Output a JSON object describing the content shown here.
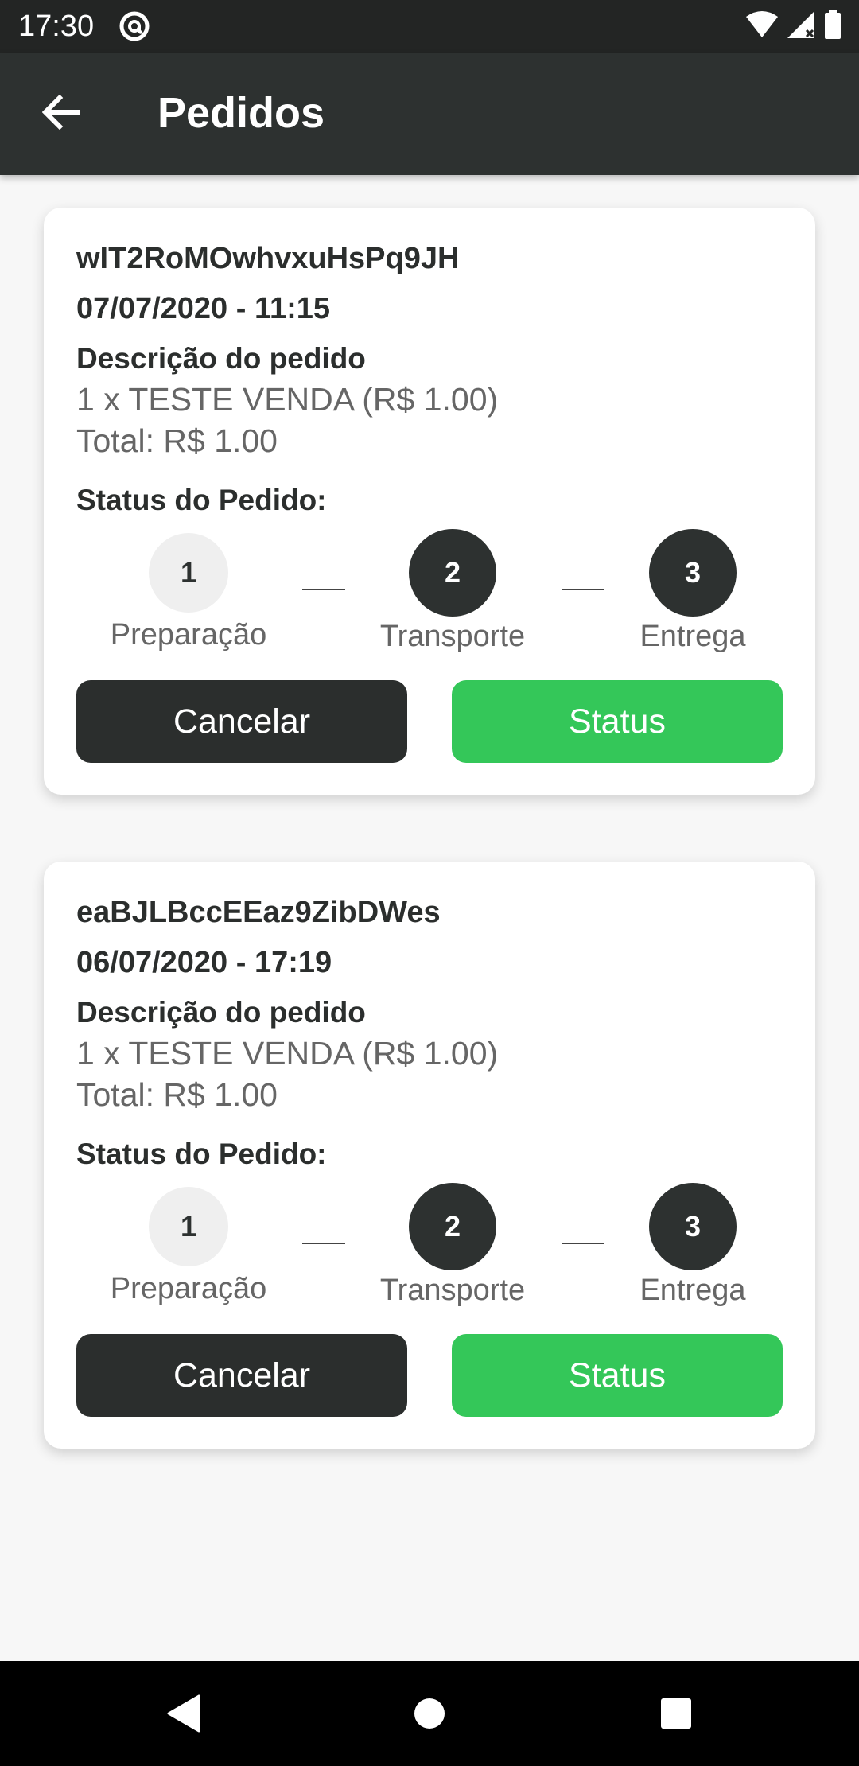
{
  "status_bar": {
    "time": "17:30",
    "icons": [
      "at-sign-icon",
      "wifi-icon",
      "signal-icon",
      "battery-icon"
    ]
  },
  "app_bar": {
    "title": "Pedidos",
    "back_icon": "arrow-left-icon"
  },
  "orders": [
    {
      "id": "wIT2RoMOwhvxuHsPq9JH",
      "datetime": "07/07/2020 - 11:15",
      "description_title": "Descrição do pedido",
      "item": "1 x TESTE VENDA (R$ 1.00)",
      "total": "Total: R$ 1.00",
      "status_title": "Status do Pedido:",
      "steps": [
        {
          "number": "1",
          "label": "Preparação"
        },
        {
          "number": "2",
          "label": "Transporte"
        },
        {
          "number": "3",
          "label": "Entrega"
        }
      ],
      "cancel_label": "Cancelar",
      "status_label": "Status"
    },
    {
      "id": "eaBJLBccEEaz9ZibDWes",
      "datetime": "06/07/2020 - 17:19",
      "description_title": "Descrição do pedido",
      "item": "1 x TESTE VENDA (R$ 1.00)",
      "total": "Total: R$ 1.00",
      "status_title": "Status do Pedido:",
      "steps": [
        {
          "number": "1",
          "label": "Preparação"
        },
        {
          "number": "2",
          "label": "Transporte"
        },
        {
          "number": "3",
          "label": "Entrega"
        }
      ],
      "cancel_label": "Cancelar",
      "status_label": "Status"
    }
  ],
  "colors": {
    "app_bar": "#2d3130",
    "status_button": "#34c759",
    "cancel_button": "#2b2e2d",
    "active_step": "#efefef"
  },
  "nav_bar": {
    "icons": [
      "back-triangle-icon",
      "home-circle-icon",
      "recents-square-icon"
    ]
  }
}
